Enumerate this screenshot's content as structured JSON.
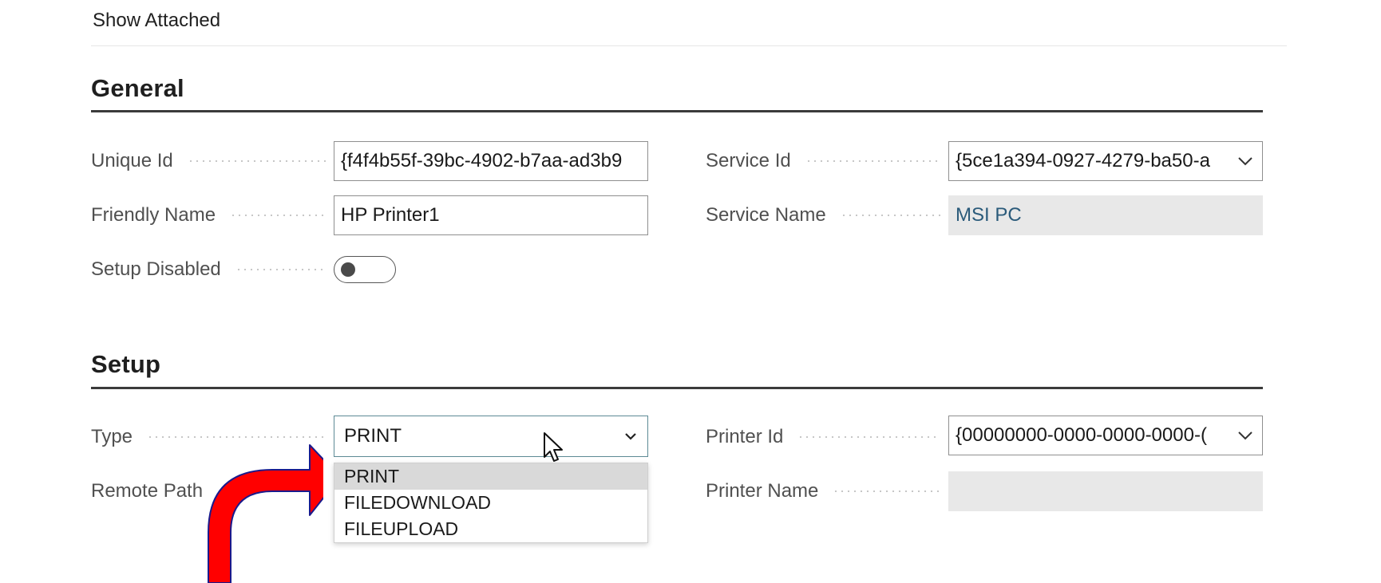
{
  "toolbar": {
    "show_attached": "Show Attached"
  },
  "general": {
    "title": "General",
    "unique_id": {
      "label": "Unique Id",
      "value": "{f4f4b55f-39bc-4902-b7aa-ad3b9"
    },
    "friendly_name": {
      "label": "Friendly Name",
      "value": "HP Printer1"
    },
    "setup_disabled": {
      "label": "Setup Disabled",
      "value": false
    },
    "service_id": {
      "label": "Service Id",
      "value": "{5ce1a394-0927-4279-ba50-a"
    },
    "service_name": {
      "label": "Service Name",
      "value": "MSI PC"
    }
  },
  "setup": {
    "title": "Setup",
    "type": {
      "label": "Type",
      "value": "PRINT",
      "options": [
        "PRINT",
        "FILEDOWNLOAD",
        "FILEUPLOAD"
      ],
      "highlighted": "PRINT"
    },
    "remote_path": {
      "label": "Remote Path"
    },
    "printer_id": {
      "label": "Printer Id",
      "value": "{00000000-0000-0000-0000-("
    },
    "printer_name": {
      "label": "Printer Name",
      "value": ""
    }
  },
  "annotation": {
    "arrow_color": "#ff0000",
    "arrow_outline": "#1a1a8c"
  },
  "colors": {
    "readonly_bg": "#e8e8e8",
    "section_rule": "#3b3b3b",
    "focus_border": "#5d8a95"
  }
}
